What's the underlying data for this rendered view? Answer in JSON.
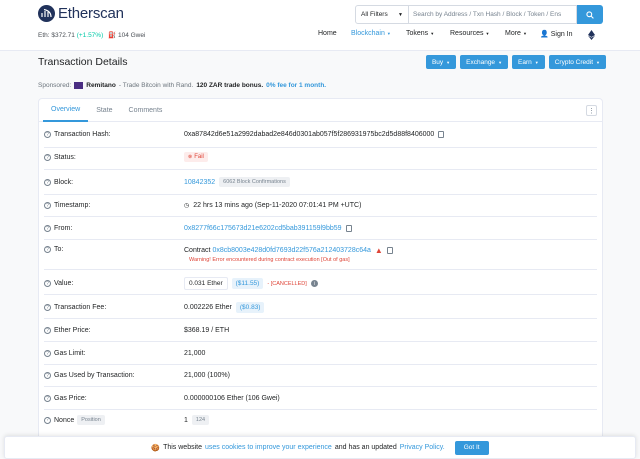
{
  "header": {
    "logo_text": "Etherscan",
    "eth_price_label": "Eth: $372.71",
    "eth_price_change": "(+1.57%)",
    "gas": "104 Gwei",
    "filter_label": "All Filters",
    "search_placeholder": "Search by Address / Txn Hash / Block / Token / Ens",
    "nav": [
      "Home",
      "Blockchain",
      "Tokens",
      "Resources",
      "More",
      "Sign In"
    ]
  },
  "page": {
    "title": "Transaction Details",
    "buttons": [
      "Buy",
      "Exchange",
      "Earn",
      "Crypto Credit"
    ]
  },
  "sponsor": {
    "label": "Sponsored:",
    "brand": "Remitano",
    "text": "- Trade Bitcoin with Rand.",
    "bonus": "120 ZAR trade bonus.",
    "fee": "0% fee for 1 month."
  },
  "tabs": [
    "Overview",
    "State",
    "Comments"
  ],
  "rows": {
    "hash_label": "Transaction Hash:",
    "hash_value": "0xa87842d6e51a2992dabad2e846d0301ab057f5f286931975bc2d5d88f8406000",
    "status_label": "Status:",
    "status_value": "Fail",
    "block_label": "Block:",
    "block_value": "10842352",
    "block_confirmations": "6062 Block Confirmations",
    "timestamp_label": "Timestamp:",
    "timestamp_value": "22 hrs 13 mins ago (Sep-11-2020 07:01:41 PM +UTC)",
    "from_label": "From:",
    "from_value": "0x8277f66c175673d21e6202cd5bab391159l9bb59",
    "to_label": "To:",
    "to_prefix": "Contract",
    "to_value": "0x8cb8003e428d0fd7693d22f576a212403728c64a",
    "to_warning": "Warning! Error encountered during contract execution [Out of gas]",
    "value_label": "Value:",
    "value_eth": "0.031 Ether",
    "value_usd": "($11.55)",
    "value_cancel": "- [CANCELLED]",
    "fee_label": "Transaction Fee:",
    "fee_eth": "0.002226 Ether",
    "fee_usd": "($0.83)",
    "ether_price_label": "Ether Price:",
    "ether_price_value": "$368.19 / ETH",
    "gas_limit_label": "Gas Limit:",
    "gas_limit_value": "21,000",
    "gas_used_label": "Gas Used by Transaction:",
    "gas_used_value": "21,000 (100%)",
    "gas_price_label": "Gas Price:",
    "gas_price_value": "0.000000106 Ether (106 Gwei)",
    "nonce_label": "Nonce",
    "nonce_tag": "Position",
    "nonce_value": "1",
    "nonce_position": "124"
  },
  "cookie": {
    "text_before": "This website",
    "link1": "uses cookies to improve your experience",
    "text_mid": "and has an updated",
    "link2": "Privacy Policy.",
    "button": "Got It"
  },
  "colors": {
    "primary": "#3498db",
    "danger": "#de4437",
    "success": "#00c9a7",
    "dark": "#21325b"
  }
}
